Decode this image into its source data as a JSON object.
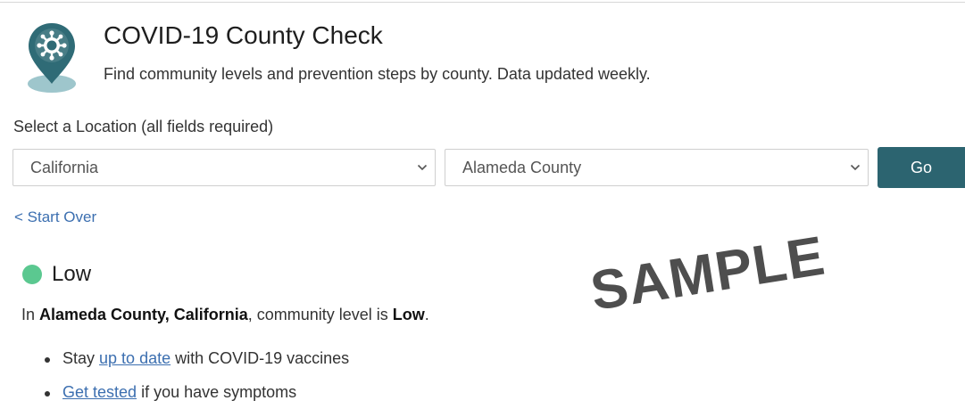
{
  "header": {
    "title": "COVID-19 County Check",
    "subtitle": "Find community levels and prevention steps by county. Data updated weekly.",
    "logo_icon": "virus-location-pin-icon"
  },
  "form": {
    "label": "Select a Location (all fields required)",
    "state_value": "California",
    "county_value": "Alameda County",
    "go_label": "Go"
  },
  "start_over": "< Start Over",
  "result": {
    "level": "Low",
    "level_color": "#5bc890",
    "summary_prefix": "In ",
    "summary_location": "Alameda County, California",
    "summary_middle": ", community level is ",
    "summary_level": "Low",
    "summary_suffix": "."
  },
  "bullets": [
    {
      "before": "Stay ",
      "link": "up to date",
      "after": " with COVID-19 vaccines"
    },
    {
      "before": "",
      "link": "Get tested",
      "after": " if you have symptoms"
    }
  ],
  "watermark": "SAMPLE",
  "colors": {
    "go_button": "#2c6470",
    "link": "#3c6fb0",
    "logo": "#2f6b76"
  }
}
